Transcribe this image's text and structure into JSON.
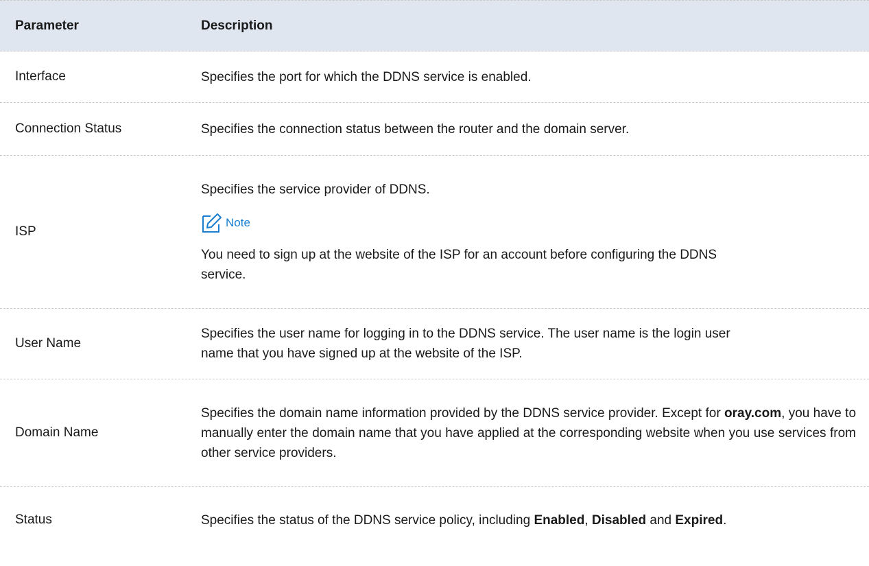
{
  "header": {
    "param": "Parameter",
    "desc": "Description"
  },
  "rows": [
    {
      "param": "Interface",
      "desc": "Specifies the port for which the DDNS service is enabled."
    },
    {
      "param": "Connection Status",
      "desc": "Specifies the connection status between the router and the domain server."
    },
    {
      "param": "ISP",
      "desc": "Specifies the service provider of DDNS.",
      "note_label": "Note",
      "note_text": "You need to sign up at the website of the ISP for an account before configuring the DDNS service."
    },
    {
      "param": "User Name",
      "desc": "Specifies the user name for logging in to the DDNS service. The user name is the login user name that you have signed up at the website of the ISP."
    },
    {
      "param": "Domain Name",
      "desc_line1": "Specifies the domain name information provided by the DDNS service provider.",
      "desc_pre": "Except for ",
      "desc_bold": "oray.com",
      "desc_post": ", you have to manually enter the domain name that you have applied at the corresponding website when you use services from other service providers."
    },
    {
      "param": "Status",
      "desc_pre": "Specifies the status of the DDNS service policy, including ",
      "bold1": "Enabled",
      "sep1": ", ",
      "bold2": "Disabled",
      "sep2": " and ",
      "bold3": "Expired",
      "end": "."
    }
  ],
  "colors": {
    "header_bg": "#dfe6f0",
    "note_blue": "#1b7fd1",
    "divider": "#c8c8c8"
  },
  "icons": {
    "note": "pencil-note-icon"
  }
}
